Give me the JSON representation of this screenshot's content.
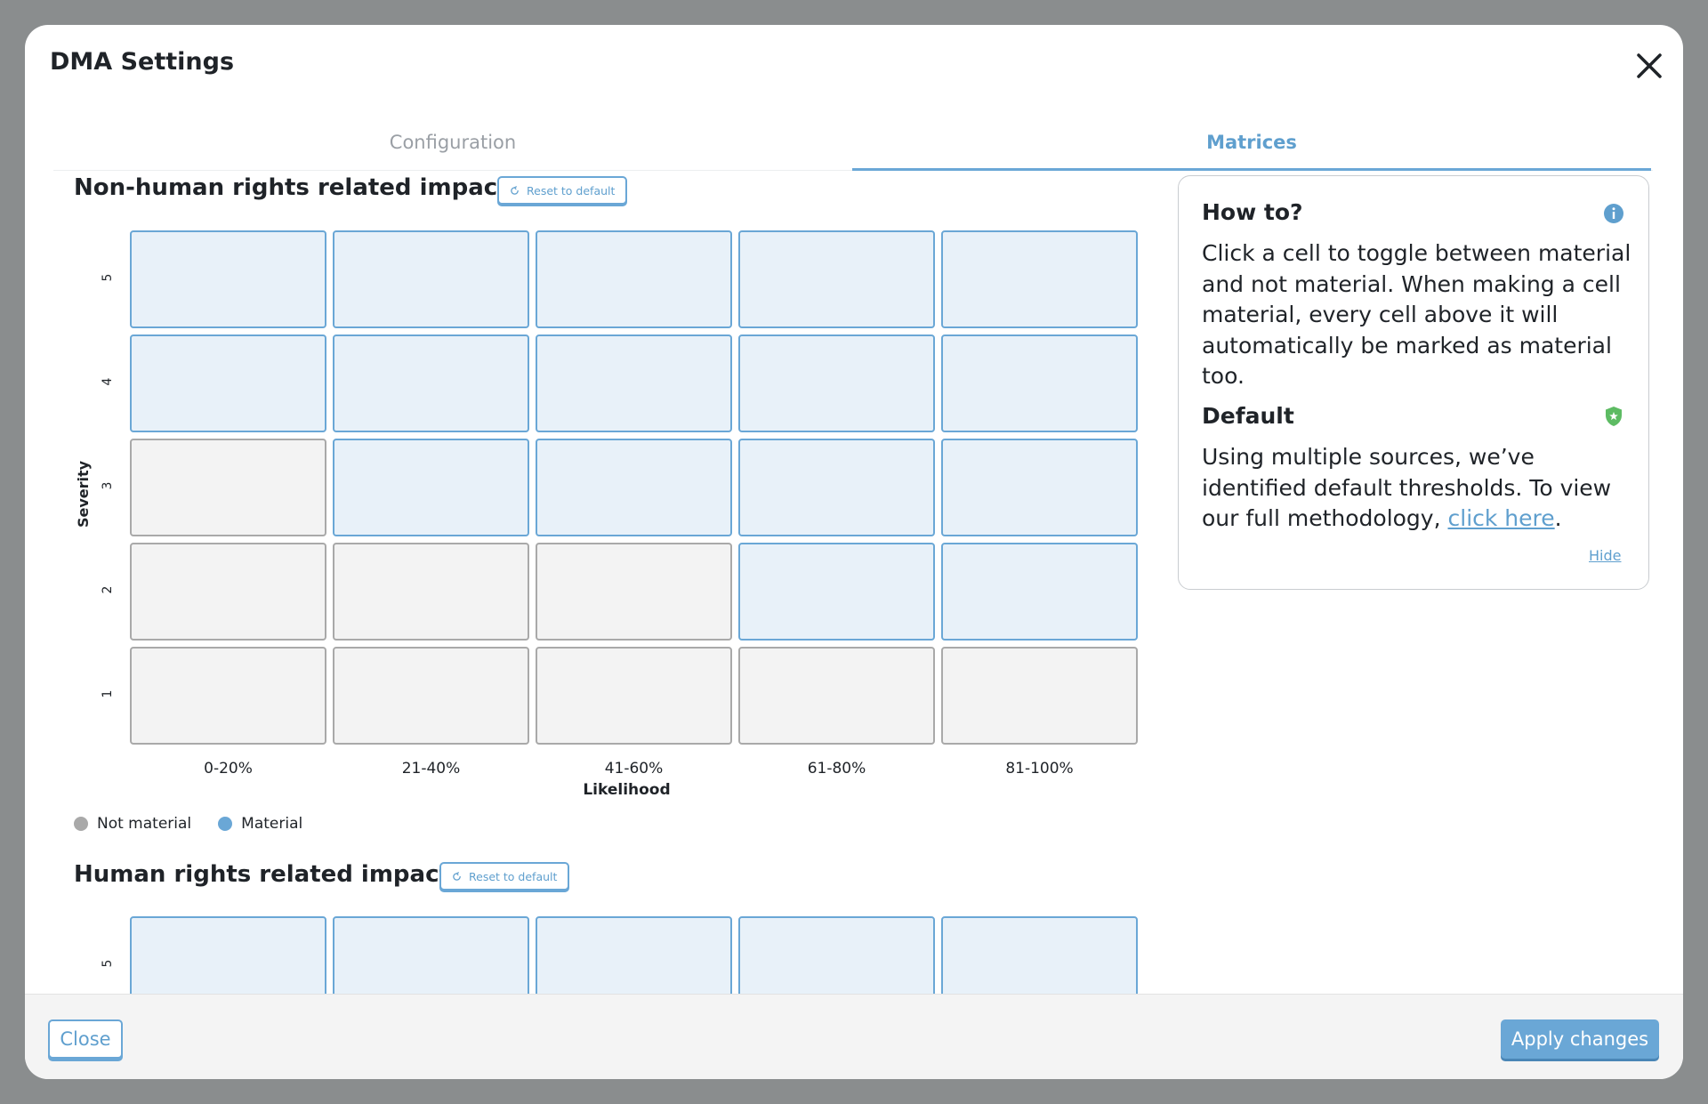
{
  "modal": {
    "title": "DMA Settings"
  },
  "tabs": [
    {
      "label": "Configuration",
      "active": false
    },
    {
      "label": "Matrices",
      "active": true
    }
  ],
  "matrices": [
    {
      "title": "Non-human rights related impact",
      "reset_label": "Reset to default",
      "y_label": "Severity",
      "x_label": "Likelihood",
      "severity_levels": [
        "5",
        "4",
        "3",
        "2",
        "1"
      ],
      "likelihood_levels": [
        "0-20%",
        "21-40%",
        "41-60%",
        "61-80%",
        "81-100%"
      ],
      "cells": [
        [
          "material",
          "material",
          "material",
          "material",
          "material"
        ],
        [
          "material",
          "material",
          "material",
          "material",
          "material"
        ],
        [
          "not",
          "material",
          "material",
          "material",
          "material"
        ],
        [
          "not",
          "not",
          "not",
          "material",
          "material"
        ],
        [
          "not",
          "not",
          "not",
          "not",
          "not"
        ]
      ]
    },
    {
      "title": "Human rights related impact",
      "reset_label": "Reset to default",
      "severity_levels": [
        "5"
      ],
      "cells": [
        [
          "material",
          "material",
          "material",
          "material",
          "material"
        ]
      ]
    }
  ],
  "legend": [
    {
      "label": "Not material",
      "color": "#a9a9a9"
    },
    {
      "label": "Material",
      "color": "#6aa7d6"
    }
  ],
  "howto": {
    "title": "How to?",
    "text": "Click a cell to toggle between material and not material. When making a cell material, every cell  above it will automatically be marked as material too.",
    "default_title": "Default",
    "default_text": "Using multiple sources, we’ve identified default thresholds. To view our full methodology, ",
    "link_label": "click here",
    "link_suffix": ".",
    "hide_label": "Hide",
    "info_icon": "info-icon",
    "shield_icon": "shield-star-icon"
  },
  "footer": {
    "close_label": "Close",
    "apply_label": "Apply changes"
  },
  "colors": {
    "accent": "#6aa7d6",
    "material_fill": "#e8f1f9",
    "not_material_fill": "#f3f3f3",
    "shield_green": "#5dbb63"
  }
}
